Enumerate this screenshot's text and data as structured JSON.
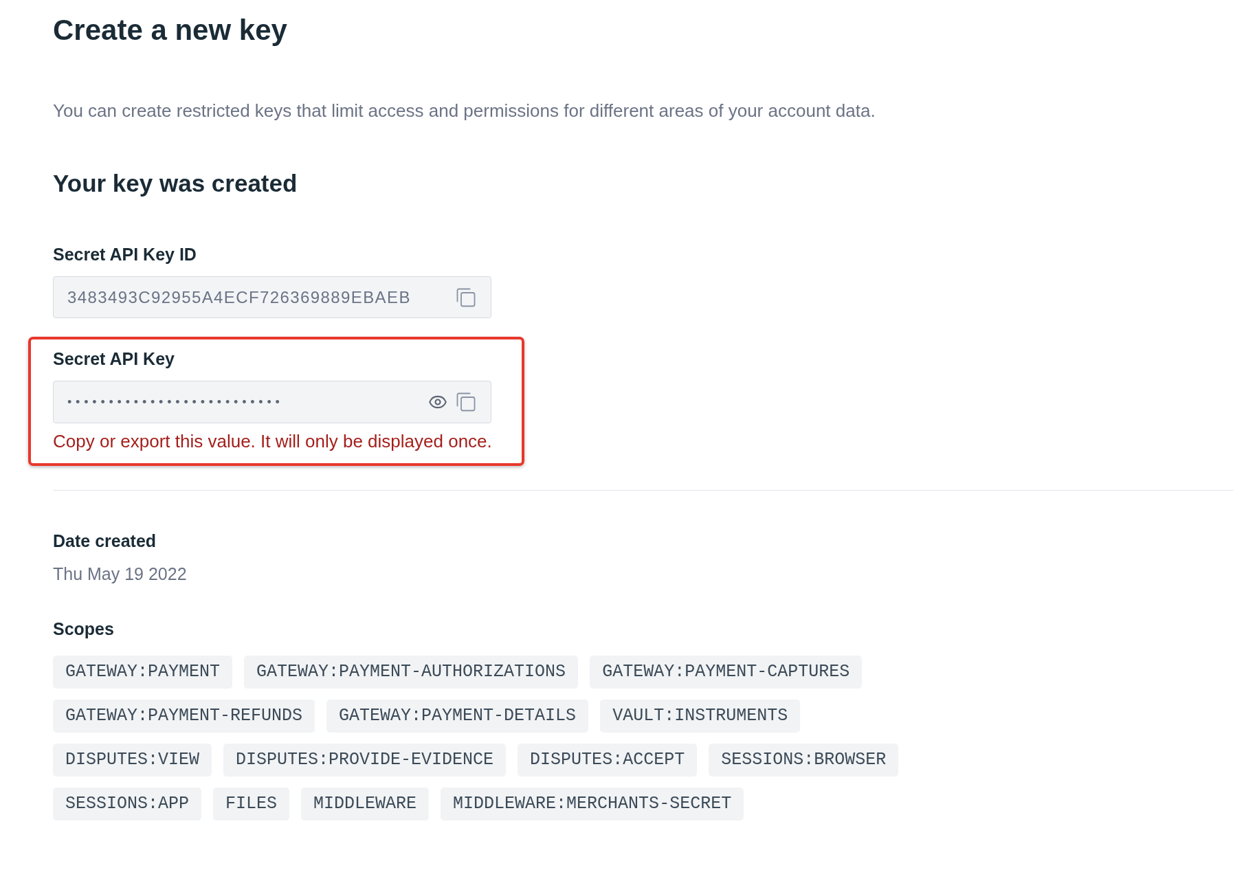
{
  "page": {
    "title": "Create a new key",
    "description": "You can create restricted keys that limit access and permissions for different areas of your account data."
  },
  "result": {
    "heading": "Your key was created"
  },
  "key_id": {
    "label": "Secret API Key ID",
    "value": "3483493C92955A4ECF726369889EBAEB"
  },
  "secret_key": {
    "label": "Secret API Key",
    "value": "••••••••••••••••••••••••••",
    "highlighted": true,
    "warning": "Copy or export this value. It will only be displayed once."
  },
  "date_created": {
    "label": "Date created",
    "value": "Thu May 19 2022"
  },
  "scopes": {
    "label": "Scopes",
    "items": [
      "GATEWAY:PAYMENT",
      "GATEWAY:PAYMENT-AUTHORIZATIONS",
      "GATEWAY:PAYMENT-CAPTURES",
      "GATEWAY:PAYMENT-REFUNDS",
      "GATEWAY:PAYMENT-DETAILS",
      "VAULT:INSTRUMENTS",
      "DISPUTES:VIEW",
      "DISPUTES:PROVIDE-EVIDENCE",
      "DISPUTES:ACCEPT",
      "SESSIONS:BROWSER",
      "SESSIONS:APP",
      "FILES",
      "MIDDLEWARE",
      "MIDDLEWARE:MERCHANTS-SECRET"
    ]
  }
}
